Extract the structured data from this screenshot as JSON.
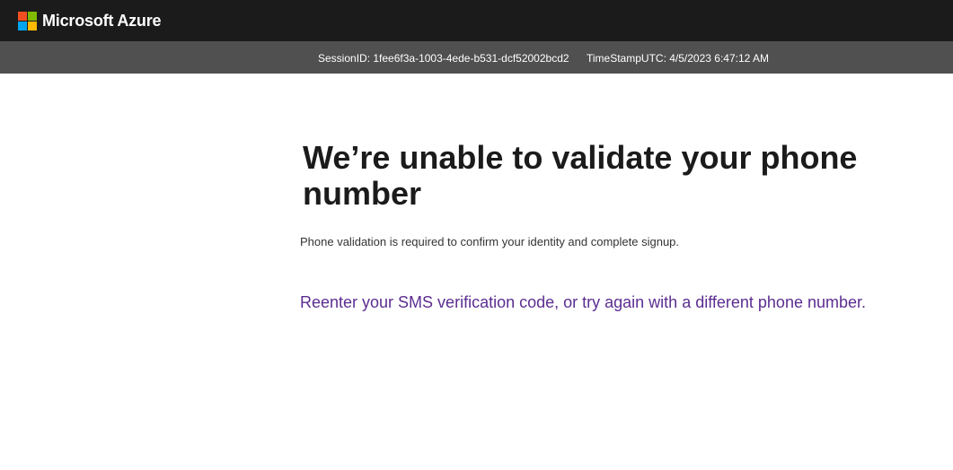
{
  "header": {
    "brand_name": "Microsoft Azure",
    "logo_colors": [
      "#f25022",
      "#7fba00",
      "#00a4ef",
      "#ffb900"
    ]
  },
  "info_bar": {
    "session_id": "SessionID: 1fee6f3a-1003-4ede-b531-dcf52002bcd2",
    "timestamp": "TimeStampUTC: 4/5/2023 6:47:12 AM"
  },
  "main": {
    "title": "We’re unable to validate your phone number",
    "subtitle": "Phone validation is required to confirm your identity and complete signup.",
    "retry_link": "Reenter your SMS verification code, or try again with a different phone number."
  },
  "colors": {
    "topbar": "#1b1b1b",
    "infobar": "#505050",
    "link": "#5c2d91"
  }
}
